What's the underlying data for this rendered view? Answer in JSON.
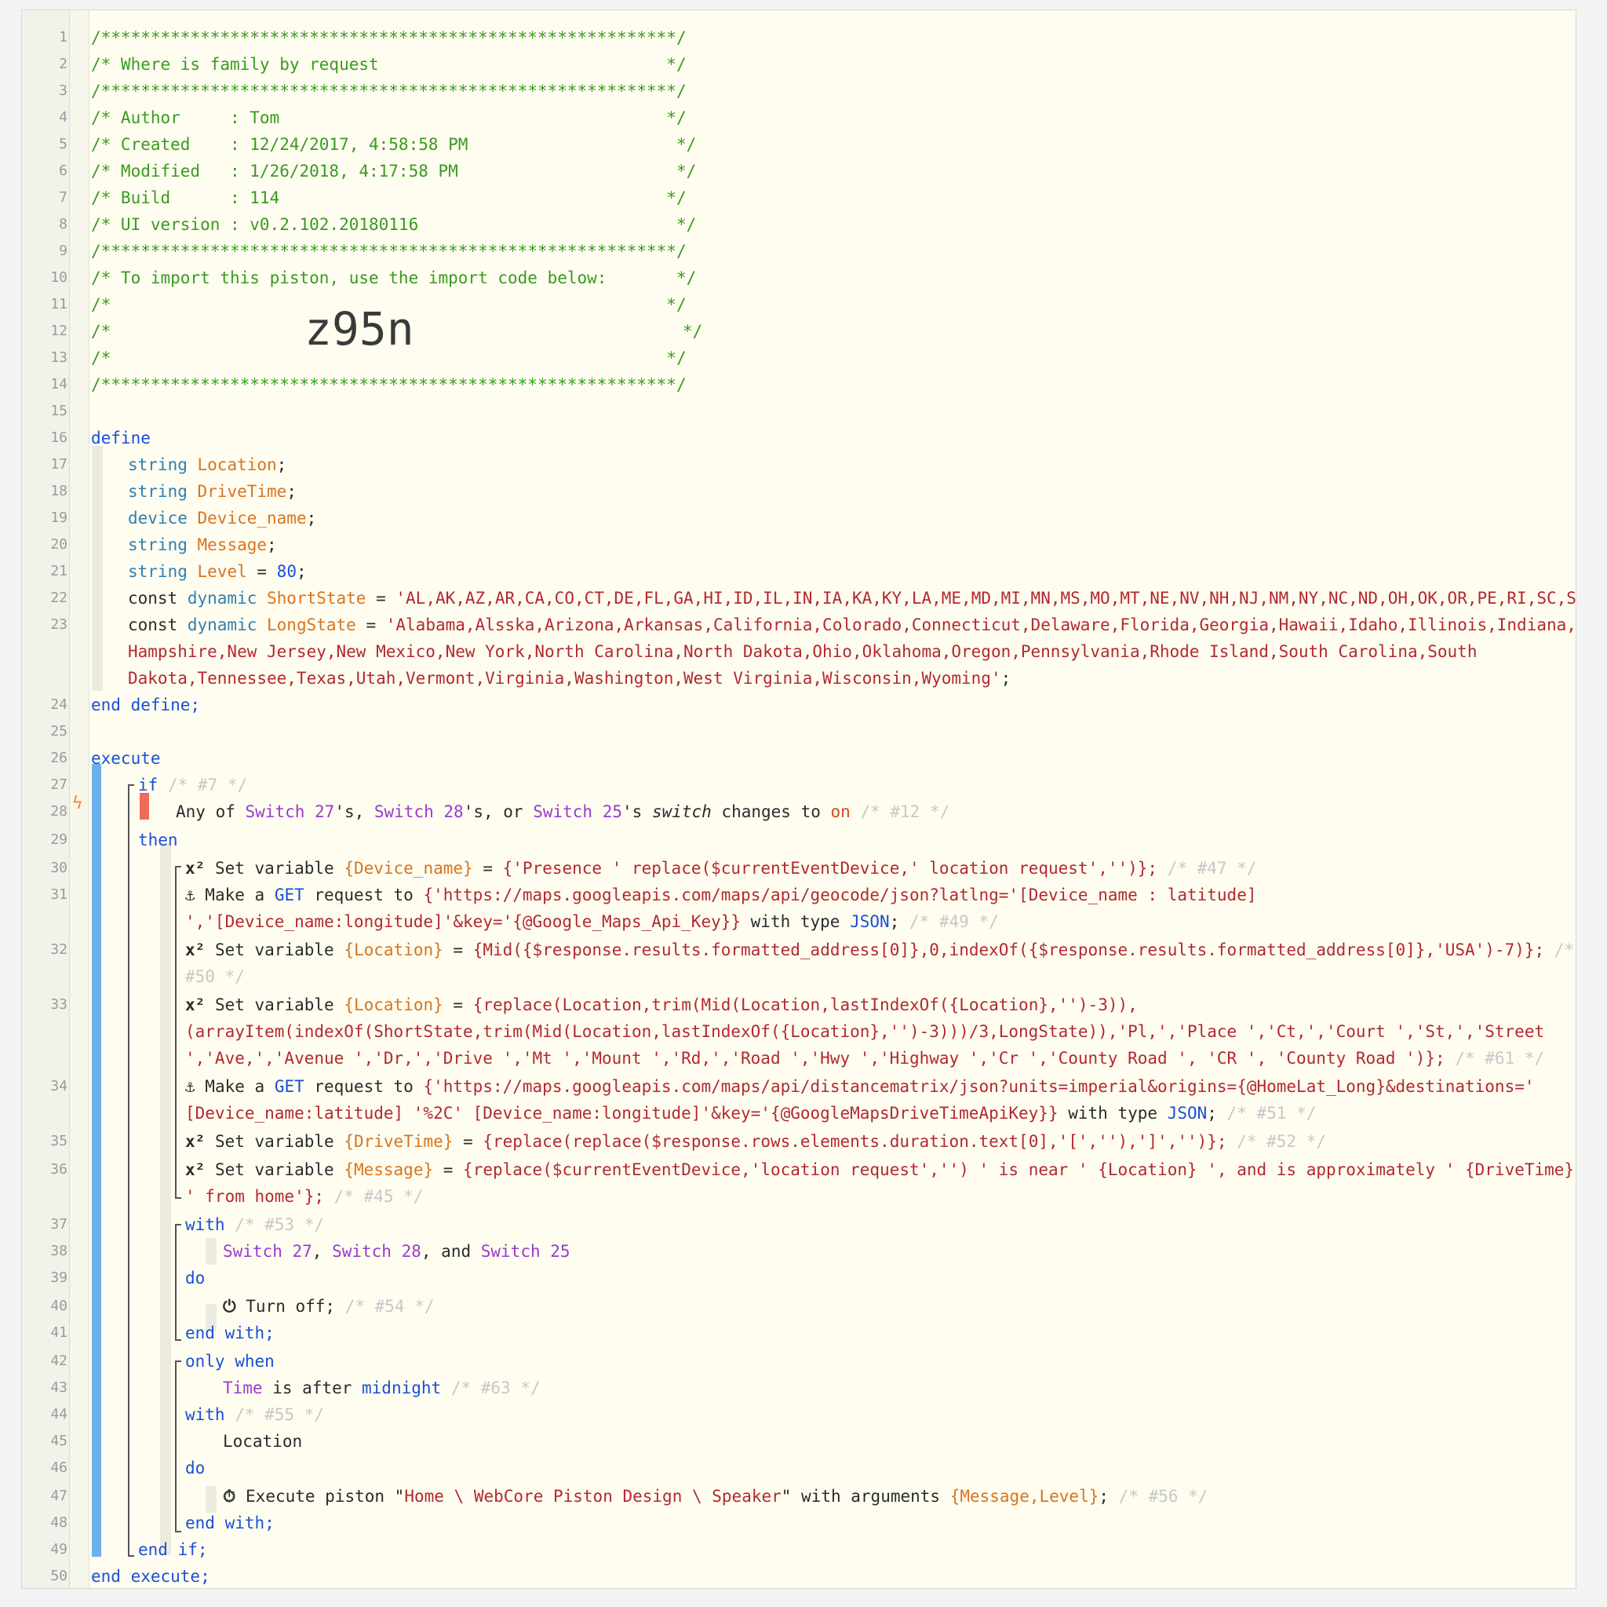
{
  "header": {
    "l1": "/**********************************************************/",
    "l2": "/* Where is family by request                             */",
    "l3": "/**********************************************************/",
    "l4": "/* Author     : Tom                                       */",
    "l5": "/* Created    : 12/24/2017, 4:58:58 PM                     */",
    "l6": "/* Modified   : 1/26/2018, 4:17:58 PM                      */",
    "l7": "/* Build      : 114                                       */",
    "l8": "/* UI version : v0.2.102.20180116                          */",
    "l9": "/**********************************************************/",
    "l10": "/* To import this piston, use the import code below:       */",
    "l11": "/*                                                        */",
    "l12a": "/*",
    "l12b": "*/",
    "import_code": "z95n",
    "l13": "/*                                                        */",
    "l14": "/**********************************************************/"
  },
  "define": {
    "kw_define": "define",
    "s17a": "string",
    "s17b": "Location",
    "s17c": ";",
    "s18a": "string",
    "s18b": "DriveTime",
    "s18c": ";",
    "s19a": "device",
    "s19b": "Device_name",
    "s19c": ";",
    "s20a": "string",
    "s20b": "Message",
    "s20c": ";",
    "s21a": "string",
    "s21b": "Level",
    "s21c": " = ",
    "s21d": "80",
    "s21e": ";",
    "s22a": "const ",
    "s22b": "dynamic",
    "s22c": " ShortState",
    "s22d": " = ",
    "s22e": "'AL,AK,AZ,AR,CA,CO,CT,DE,FL,GA,HI,ID,IL,IN,IA,KA,KY,LA,ME,MD,MI,MN,MS,MO,MT,NE,NV,NH,NJ,NM,NY,NC,ND,OH,OK,OR,PE,RI,SC,SD,TN,'",
    "s23a": "const ",
    "s23b": "dynamic",
    "s23c": " LongState",
    "s23d": " = ",
    "s23e": "'Alabama,Alsska,Arizona,Arkansas,California,Colorado,Connecticut,Delaware,Florida,Georgia,Hawaii,Idaho,Illinois,Indiana,Iowa,",
    "s23f": "Hampshire,New Jersey,New Mexico,New York,North Carolina,North Dakota,Ohio,Oklahoma,Oregon,Pennsylvania,Rhode Island,South Carolina,South",
    "s23g": "Dakota,Tennessee,Texas,Utah,Vermont,Virginia,Washington,West Virginia,Wisconsin,Wyoming'",
    "s23h": ";",
    "end_define": "end define;"
  },
  "execute": {
    "kw_execute": "execute",
    "if": "if",
    "if_id": " /* #7 */",
    "c28a": "Any of ",
    "c28b": "Switch 27",
    "c28c": "'s, ",
    "c28d": "Switch 28",
    "c28e": "'s, or ",
    "c28f": "Switch 25",
    "c28g": "'s ",
    "c28h": "switch",
    "c28i": " changes to ",
    "c28j": "on",
    "c28k": " /* #12 */",
    "then": "then",
    "x2": "x²",
    "anchor": "⚓",
    "sv": " Set variable ",
    "s30a": "{Device_name}",
    "s30b": " = ",
    "s30c": "{'Presence ' replace($currentEventDevice,' location request','')};",
    "s30d": " /* #47 */",
    "s31a": " Make a ",
    "s31b": "GET",
    "s31c": " request to ",
    "s31d": "{'https://maps.googleapis.com/maps/api/geocode/json?latlng='[Device_name : latitude]",
    "s31e": "','[Device_name:longitude]'&key='{@Google_Maps_Api_Key}}",
    "s31f": " with type ",
    "s31g": "JSON",
    "s31h": ";",
    "s31i": " /* #49 */",
    "s32a": "{Location}",
    "s32b": " = ",
    "s32c": "{Mid({$response.results.formatted_address[0]},0,indexOf({$response.results.formatted_address[0]},'USA')-7)};",
    "s32d": " /*",
    "s32e": "#50 */",
    "s33a": "{Location}",
    "s33b": " = ",
    "s33c": "{replace(Location,trim(Mid(Location,lastIndexOf({Location},'')-3)),",
    "s33d": "(arrayItem(indexOf(ShortState,trim(Mid(Location,lastIndexOf({Location},'')-3)))/3,LongState)),'Pl,','Place ','Ct,','Court ','St,','Street",
    "s33e": "','Ave,','Avenue ','Dr,','Drive ','Mt ','Mount ','Rd,','Road ','Hwy ','Highway ','Cr ','County Road ', 'CR ', 'County Road ')};",
    "s33f": " /* #61 */",
    "s34a": " Make a ",
    "s34b": "GET",
    "s34c": " request to ",
    "s34d": "{'https://maps.googleapis.com/maps/api/distancematrix/json?units=imperial&origins={@HomeLat_Long}&destinations='",
    "s34e": "[Device_name:latitude] '%2C' [Device_name:longitude]'&key='{@GoogleMapsDriveTimeApiKey}}",
    "s34f": " with type ",
    "s34g": "JSON",
    "s34h": ";",
    "s34i": " /* #51 */",
    "s35a": "{DriveTime}",
    "s35b": " = ",
    "s35c": "{replace(replace($response.rows.elements.duration.text[0],'[',''),']','')};",
    "s35d": " /* #52 */",
    "s36a": "{Message}",
    "s36b": " = ",
    "s36c": "{replace($currentEventDevice,'location request','') ' is near ' {Location} ', and is approximately ' {DriveTime}",
    "s36d": "' from home'};",
    "s36e": " /* #45 */",
    "with": "with",
    "with_id1": " /* #53 */",
    "s38a": "Switch 27",
    "s38b": ", ",
    "s38c": "Switch 28",
    "s38d": ", and ",
    "s38e": "Switch 25",
    "do": "do",
    "power": "⏻",
    "s40a": " Turn off;",
    "s40b": " /* #54 */",
    "end_with": "end with;",
    "only_when": "only when",
    "s43a": "Time",
    "s43b": " is after ",
    "s43c": "midnight",
    "s43d": " /* #63 */",
    "with_id2": " /* #55 */",
    "s45": "Location",
    "clock": "⏱",
    "s47a": " Execute piston \"",
    "s47b": "Home \\ WebCore Piston Design \\ Speaker",
    "s47c": "\" with arguments ",
    "s47d": "{Message,Level}",
    "s47e": ";",
    "s47f": " /* #56 */",
    "end_if": "end if;",
    "end_execute": "end execute;"
  },
  "line_numbers": [
    "1",
    "2",
    "3",
    "4",
    "5",
    "6",
    "7",
    "8",
    "9",
    "10",
    "11",
    "12",
    "13",
    "14",
    "15",
    "16",
    "17",
    "18",
    "19",
    "20",
    "21",
    "22",
    "23",
    "24",
    "25",
    "26",
    "27",
    "28",
    "29",
    "30",
    "31",
    "32",
    "33",
    "34",
    "35",
    "36",
    "37",
    "38",
    "39",
    "40",
    "41",
    "42",
    "43",
    "44",
    "45",
    "46",
    "47",
    "48",
    "49",
    "50"
  ]
}
